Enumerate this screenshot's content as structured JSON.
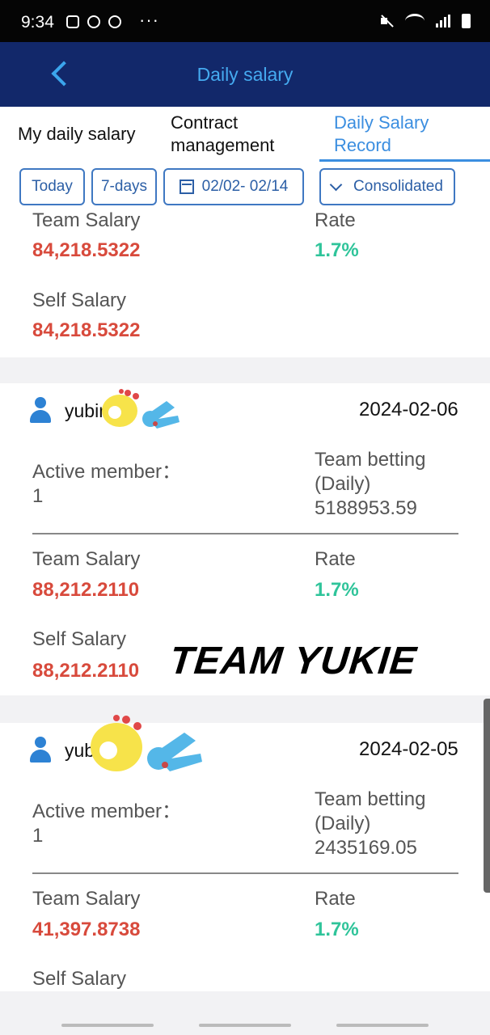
{
  "status_bar": {
    "time": "9:34",
    "dots": "···"
  },
  "header": {
    "title": "Daily salary"
  },
  "tabs": [
    {
      "label": "My daily salary"
    },
    {
      "label_line1": "Contract",
      "label_line2": "management"
    },
    {
      "label_line1": "Daily Salary",
      "label_line2": "Record"
    }
  ],
  "filters": {
    "today": "Today",
    "seven_days": "7-days",
    "date_range": "02/02- 02/14",
    "mode": "Consolidated"
  },
  "labels": {
    "team_salary": "Team Salary",
    "rate": "Rate",
    "self_salary": "Self Salary",
    "active_member": "Active member：",
    "team_betting_line1": "Team betting",
    "team_betting_line2": "(Daily)"
  },
  "top_partial": {
    "team_salary": "84,218.5322",
    "rate": "1.7%",
    "self_salary": "84,218.5322"
  },
  "records": [
    {
      "user": "yubin",
      "date": "2024-02-06",
      "active_member": "1",
      "team_betting": "5188953.59",
      "team_salary": "88,212.2110",
      "rate": "1.7%",
      "self_salary": "88,212.2110"
    },
    {
      "user": "yubin",
      "date": "2024-02-05",
      "active_member": "1",
      "team_betting": "2435169.05",
      "team_salary": "41,397.8738",
      "rate": "1.7%"
    }
  ],
  "watermark": "TEAM YUKIE",
  "colors": {
    "header_bg": "#12286a",
    "accent": "#3b8ee0",
    "salary_red": "#d84a3c",
    "rate_green": "#2fc49a"
  }
}
